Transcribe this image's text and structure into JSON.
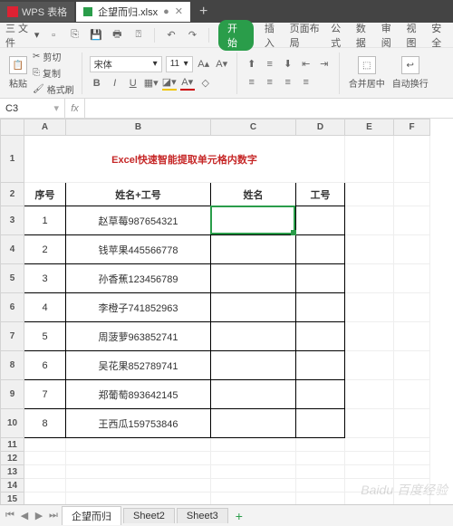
{
  "titlebar": {
    "app_name": "WPS 表格",
    "file_tab": "企望而归.xlsx",
    "dirty": "●"
  },
  "quickbar": {
    "menu_label": "三 文件",
    "start_pill": "开始",
    "tabs": [
      "插入",
      "页面布局",
      "公式",
      "数据",
      "审阅",
      "视图",
      "安全"
    ]
  },
  "ribbon": {
    "paste_label": "粘贴",
    "cut": "剪切",
    "copy": "复制",
    "format_painter": "格式刷",
    "font_name": "宋体",
    "font_size": "11",
    "merge_label": "合并居中",
    "wrap_label": "自动换行"
  },
  "formula_bar": {
    "cell_ref": "C3",
    "fx_symbol": "fx",
    "value": ""
  },
  "columns": [
    "A",
    "B",
    "C",
    "D",
    "E",
    "F"
  ],
  "title_text": "Excel快速智能提取单元格内数字",
  "headers": {
    "A": "序号",
    "B": "姓名+工号",
    "C": "姓名",
    "D": "工号"
  },
  "rows": [
    {
      "n": "1",
      "b": "赵草莓987654321"
    },
    {
      "n": "2",
      "b": "钱苹果445566778"
    },
    {
      "n": "3",
      "b": "孙香蕉123456789"
    },
    {
      "n": "4",
      "b": "李橙子741852963"
    },
    {
      "n": "5",
      "b": "周菠萝963852741"
    },
    {
      "n": "6",
      "b": "吴花果852789741"
    },
    {
      "n": "7",
      "b": "郑葡萄893642145"
    },
    {
      "n": "8",
      "b": "王西瓜159753846"
    }
  ],
  "sheet_tabs": [
    "企望而归",
    "Sheet2",
    "Sheet3"
  ],
  "watermark": "Baidu 百度经验"
}
